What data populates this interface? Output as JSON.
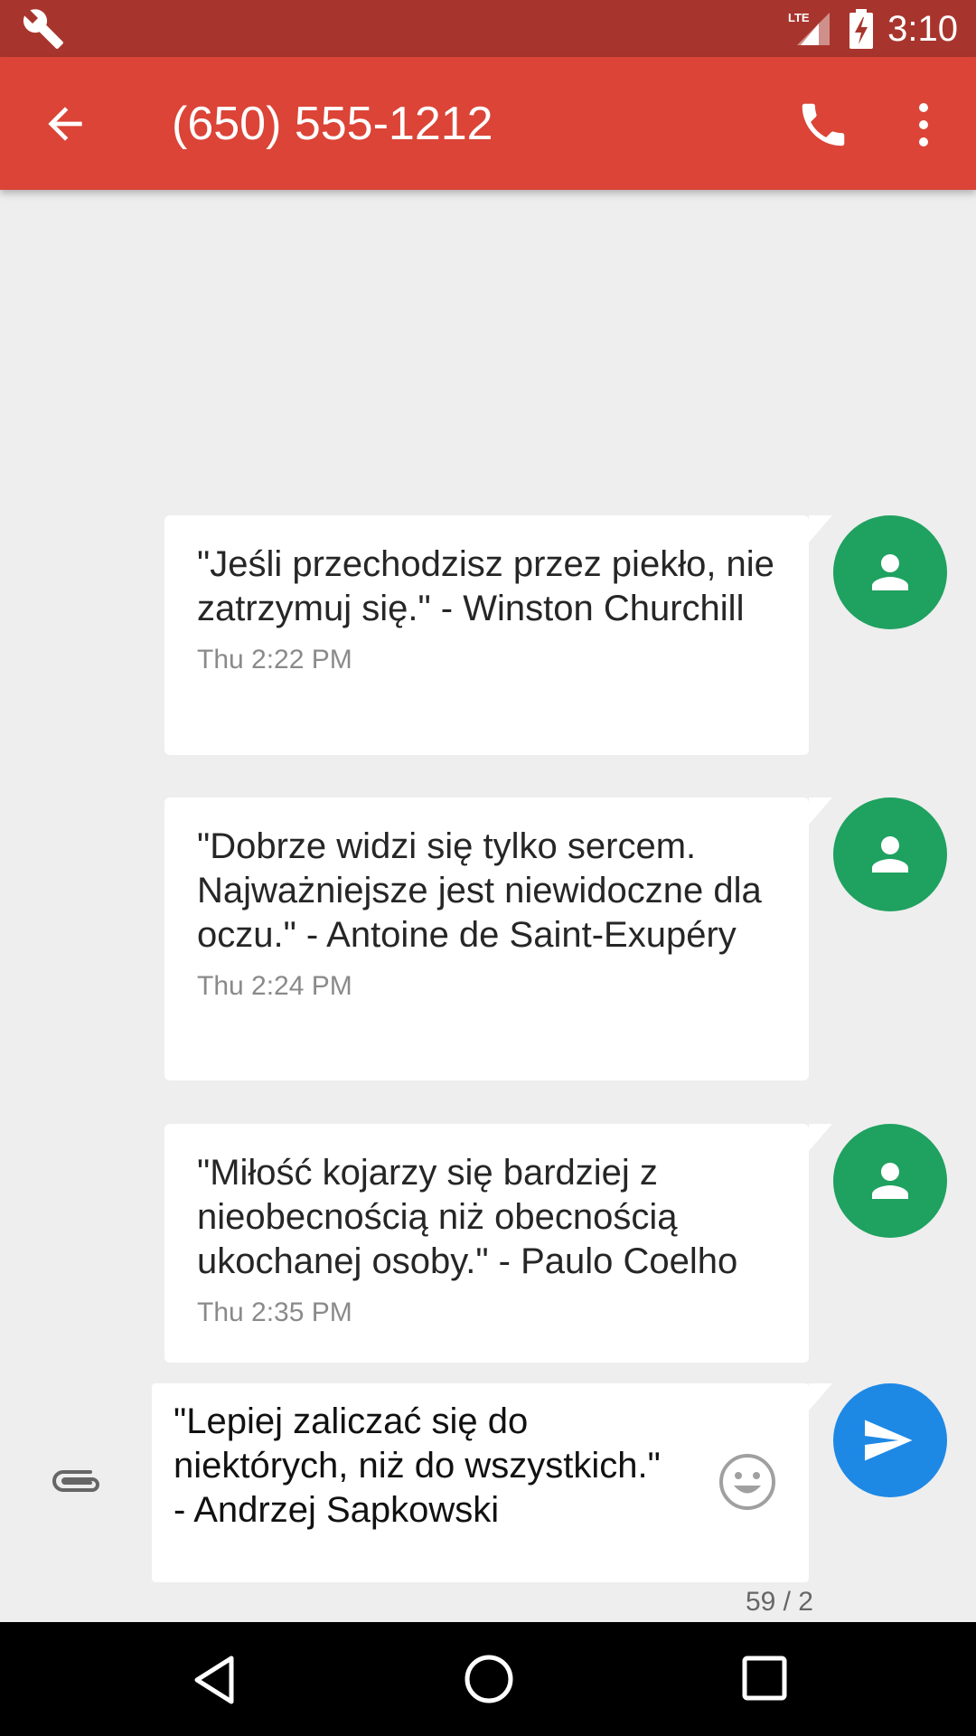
{
  "status_bar": {
    "network_label": "LTE",
    "time": "3:10"
  },
  "toolbar": {
    "title": "(650) 555-1212",
    "back_icon": "arrow-back-icon",
    "call_icon": "phone-icon",
    "menu_icon": "more-vert-icon",
    "color": "#db4437"
  },
  "messages": [
    {
      "text": "\"Jeśli przechodzisz przez piekło, nie zatrzymuj się.\" - Winston Churchill",
      "timestamp": "Thu 2:22 PM",
      "avatar_icon": "person-icon"
    },
    {
      "text": "\"Dobrze widzi się tylko sercem. Najważniejsze jest niewidoczne dla oczu.\" - Antoine de Saint-Exupéry",
      "timestamp": "Thu 2:24 PM",
      "avatar_icon": "person-icon"
    },
    {
      "text": "\"Miłość kojarzy się bardziej z nieobecnością niż obecnością ukochanej osoby.\" - Paulo Coelho",
      "timestamp": "Thu 2:35 PM",
      "avatar_icon": "person-icon"
    }
  ],
  "compose": {
    "value": "\"Lepiej zaliczać się do niektórych, niż do wszystkich.\" - Andrzej Sapkowski",
    "counter": "59 / 2",
    "attach_icon": "paperclip-icon",
    "emoji_icon": "emoji-icon",
    "send_icon": "send-icon"
  },
  "colors": {
    "avatar": "#1fa160",
    "send": "#1e88e5",
    "status_bar": "#a8352d"
  },
  "nav_bar": {
    "back_icon": "nav-back-icon",
    "home_icon": "nav-home-icon",
    "recents_icon": "nav-recents-icon"
  }
}
